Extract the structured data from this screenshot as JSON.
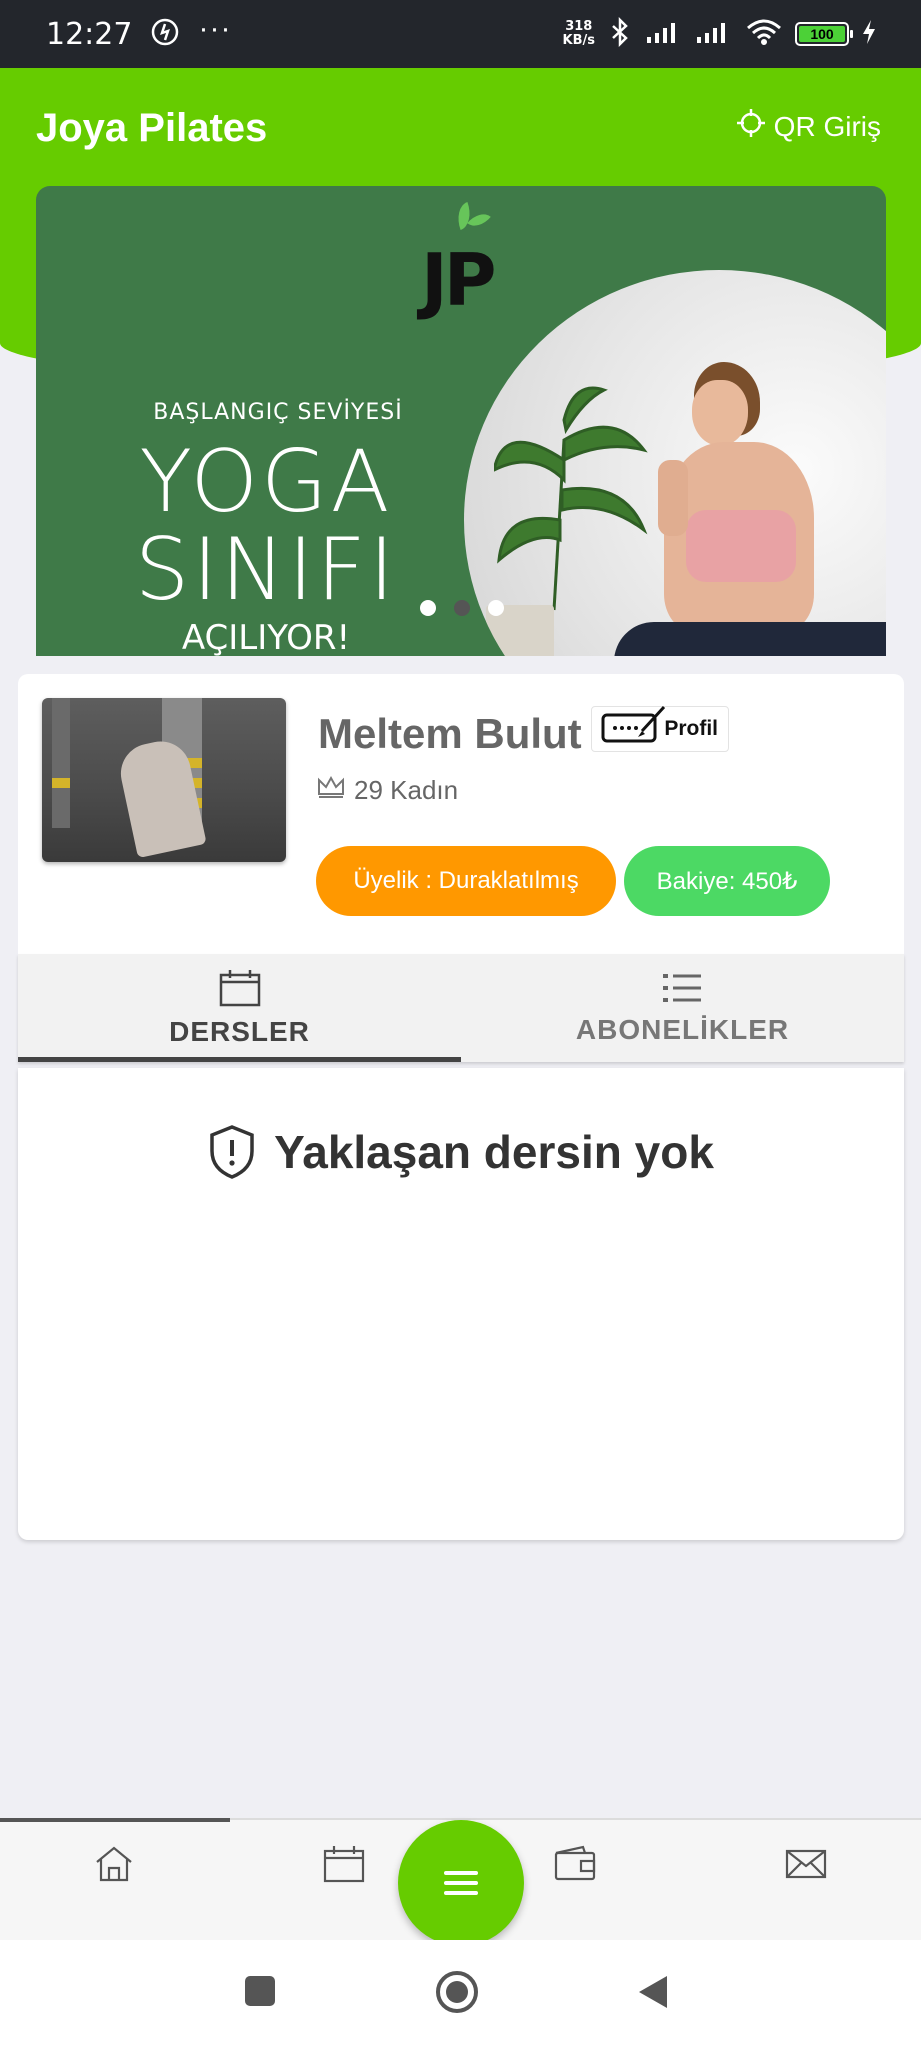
{
  "status_bar": {
    "time": "12:27",
    "more": "···",
    "net_speed_value": "318",
    "net_speed_unit": "KB/s",
    "battery": "100"
  },
  "header": {
    "title": "Joya Pilates",
    "qr_label": "QR Giriş"
  },
  "banner": {
    "logo": "JP",
    "subtitle": "BAŞLANGIÇ SEVİYESİ",
    "line1": "YOGA",
    "line2": "SINIFI",
    "line3": "AÇILIYOR!",
    "slides": 3,
    "active_slide": 1
  },
  "profile": {
    "name": "Meltem Bulut",
    "profile_button": "Profil",
    "meta": "29 Kadın",
    "membership": "Üyelik : Duraklatılmış",
    "balance": "Bakiye: 450₺"
  },
  "tabs": [
    {
      "label": "DERSLER",
      "icon": "calendar-icon",
      "active": true
    },
    {
      "label": "ABONELİKLER",
      "icon": "list-icon",
      "active": false
    }
  ],
  "empty_state": {
    "icon": "shield-alert-icon",
    "text": "Yaklaşan dersin yok"
  },
  "bottom_nav": {
    "items": [
      "home-icon",
      "calendar-icon",
      "menu-icon",
      "wallet-icon",
      "mail-icon"
    ],
    "active": "home-icon"
  },
  "colors": {
    "brand_green": "#66cc00",
    "membership_orange": "#ff9800",
    "balance_green": "#4cd964",
    "banner_green": "#3f7a48"
  }
}
